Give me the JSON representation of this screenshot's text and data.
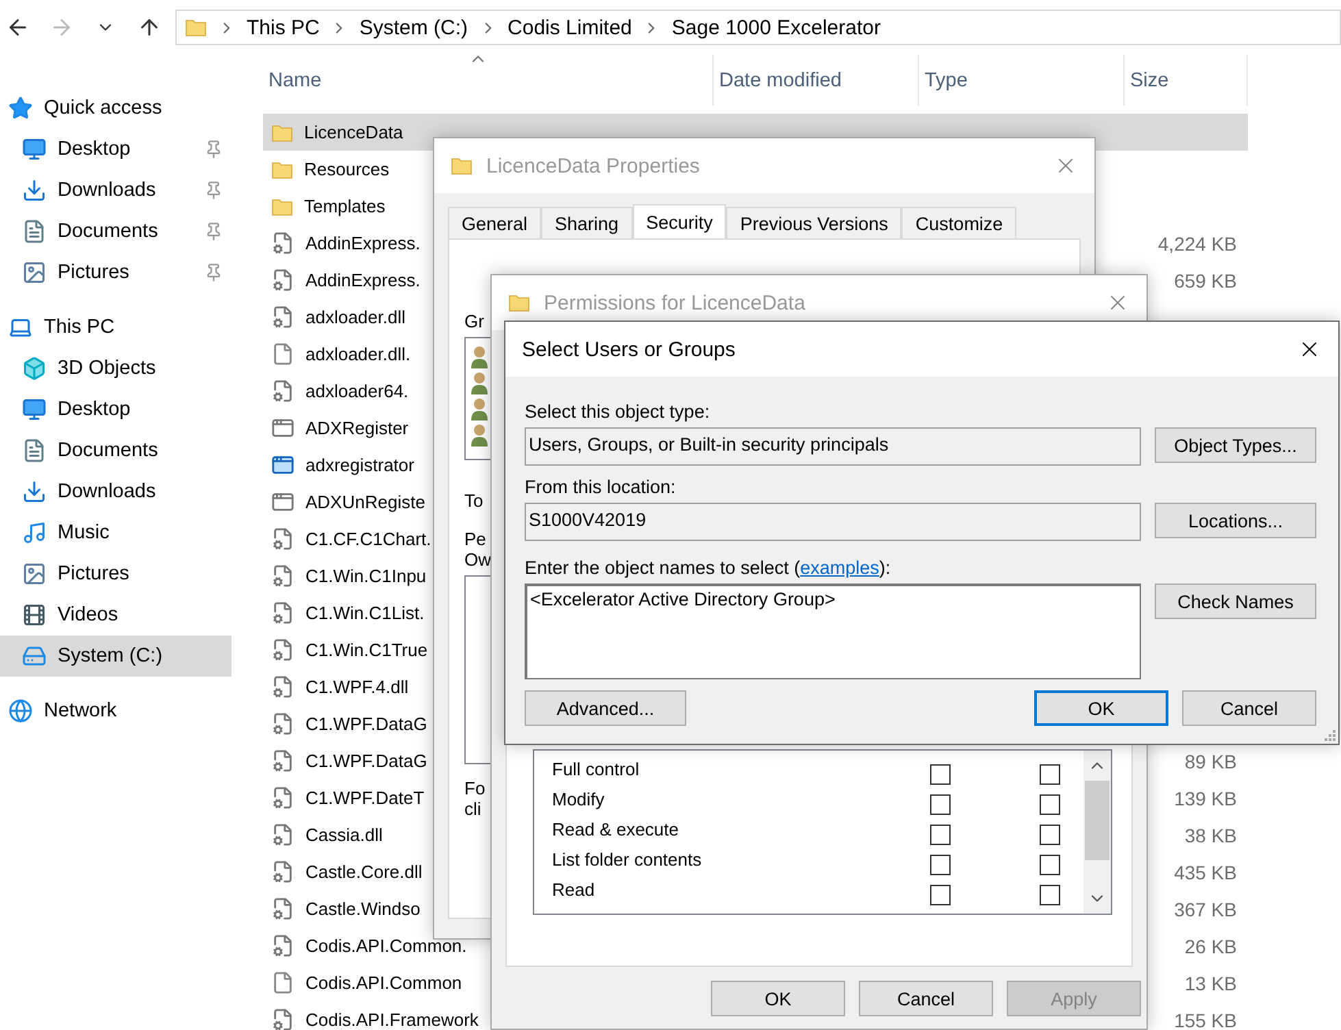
{
  "explorer": {
    "breadcrumb": [
      "This PC",
      "System (C:)",
      "Codis Limited",
      "Sage 1000 Excelerator"
    ],
    "sidebar": [
      {
        "label": "Quick access",
        "kind": "star",
        "selected": false,
        "children": [
          {
            "label": "Desktop",
            "kind": "desktop",
            "pinned": true,
            "selected": false
          },
          {
            "label": "Downloads",
            "kind": "download",
            "pinned": true,
            "selected": false
          },
          {
            "label": "Documents",
            "kind": "document",
            "pinned": true,
            "selected": false
          },
          {
            "label": "Pictures",
            "kind": "picture",
            "pinned": true,
            "selected": false
          }
        ]
      },
      {
        "label": "This PC",
        "kind": "pc",
        "selected": false,
        "children": [
          {
            "label": "3D Objects",
            "kind": "cube",
            "pinned": false,
            "selected": false
          },
          {
            "label": "Desktop",
            "kind": "desktop",
            "pinned": false,
            "selected": false
          },
          {
            "label": "Documents",
            "kind": "document",
            "pinned": false,
            "selected": false
          },
          {
            "label": "Downloads",
            "kind": "download",
            "pinned": false,
            "selected": false
          },
          {
            "label": "Music",
            "kind": "music",
            "pinned": false,
            "selected": false
          },
          {
            "label": "Pictures",
            "kind": "picture",
            "pinned": false,
            "selected": false
          },
          {
            "label": "Videos",
            "kind": "video",
            "pinned": false,
            "selected": false
          },
          {
            "label": "System (C:)",
            "kind": "drive",
            "pinned": false,
            "selected": true
          }
        ]
      },
      {
        "label": "Network",
        "kind": "network",
        "selected": false
      }
    ],
    "columns": [
      {
        "label": "Name",
        "sorted": true
      },
      {
        "label": "Date modified",
        "sorted": false
      },
      {
        "label": "Type",
        "sorted": false
      },
      {
        "label": "Size",
        "sorted": false
      }
    ],
    "files": [
      {
        "name": "LicenceData",
        "kind": "folder",
        "selected": true
      },
      {
        "name": "Resources",
        "kind": "folder",
        "selected": false
      },
      {
        "name": "Templates",
        "kind": "folder",
        "selected": false
      },
      {
        "name": "AddinExpress.",
        "kind": "dll",
        "selected": false,
        "size": "4,224 KB"
      },
      {
        "name": "AddinExpress.",
        "kind": "dll",
        "selected": false,
        "size": "659 KB"
      },
      {
        "name": "adxloader.dll",
        "kind": "dll",
        "selected": false
      },
      {
        "name": "adxloader.dll.",
        "kind": "file",
        "selected": false
      },
      {
        "name": "adxloader64.",
        "kind": "dll",
        "selected": false
      },
      {
        "name": "ADXRegister",
        "kind": "exe",
        "selected": false
      },
      {
        "name": "adxregistrator",
        "kind": "app",
        "selected": false
      },
      {
        "name": "ADXUnRegiste",
        "kind": "exe",
        "selected": false
      },
      {
        "name": "C1.CF.C1Chart.",
        "kind": "dll",
        "selected": false
      },
      {
        "name": "C1.Win.C1Inpu",
        "kind": "dll",
        "selected": false
      },
      {
        "name": "C1.Win.C1List.",
        "kind": "dll",
        "selected": false
      },
      {
        "name": "C1.Win.C1True",
        "kind": "dll",
        "selected": false
      },
      {
        "name": "C1.WPF.4.dll",
        "kind": "dll",
        "selected": false
      },
      {
        "name": "C1.WPF.DataG",
        "kind": "dll",
        "selected": false
      },
      {
        "name": "C1.WPF.DataG",
        "kind": "dll",
        "selected": false,
        "size": "89 KB"
      },
      {
        "name": "C1.WPF.DateT",
        "kind": "dll",
        "selected": false,
        "size": "139 KB"
      },
      {
        "name": "Cassia.dll",
        "kind": "dll",
        "selected": false,
        "size": "38 KB"
      },
      {
        "name": "Castle.Core.dll",
        "kind": "dll",
        "selected": false,
        "size": "435 KB"
      },
      {
        "name": "Castle.Windso",
        "kind": "dll",
        "selected": false,
        "size": "367 KB"
      },
      {
        "name": "Codis.API.Common.",
        "kind": "dll",
        "selected": false,
        "size": "26 KB"
      },
      {
        "name": "Codis.API.Common",
        "kind": "file",
        "selected": false,
        "size": "13 KB"
      },
      {
        "name": "Codis.API.Framework",
        "kind": "dll",
        "selected": false,
        "size": "155 KB"
      }
    ]
  },
  "properties": {
    "title": "LicenceData Properties",
    "tabs": [
      {
        "label": "General",
        "selected": false
      },
      {
        "label": "Sharing",
        "selected": false
      },
      {
        "label": "Security",
        "selected": true
      },
      {
        "label": "Previous Versions",
        "selected": false
      },
      {
        "label": "Customize",
        "selected": false
      }
    ],
    "group_label": "Gr",
    "to_label": "To",
    "perm_label": "Pe",
    "perm_label_2": "Ow",
    "footer_label": "Fo",
    "footer_label_2": "cli"
  },
  "permissions": {
    "title": "Permissions for LicenceData",
    "entries": [
      {
        "name": "Full control",
        "allow": false,
        "deny": false
      },
      {
        "name": "Modify",
        "allow": false,
        "deny": false
      },
      {
        "name": "Read & execute",
        "allow": false,
        "deny": false
      },
      {
        "name": "List folder contents",
        "allow": false,
        "deny": false
      },
      {
        "name": "Read",
        "allow": false,
        "deny": false
      }
    ],
    "buttons": [
      {
        "label": "OK",
        "disabled": false
      },
      {
        "label": "Cancel",
        "disabled": false
      },
      {
        "label": "Apply",
        "disabled": true
      }
    ]
  },
  "select": {
    "title": "Select Users or Groups",
    "object_type_label": "Select this object type:",
    "object_type": "Users, Groups, or Built-in security principals",
    "object_types_button": "Object Types...",
    "location_label": "From this location:",
    "location": "S1000V42019",
    "locations_button": "Locations...",
    "names_label": "Enter the object names to select (",
    "names_link": "examples",
    "names_label_end": "):",
    "names_value": "<Excelerator Active Directory Group>",
    "check_names_button": "Check Names",
    "buttons": [
      {
        "label": "Advanced...",
        "default": false
      },
      {
        "label": "OK",
        "default": true
      },
      {
        "label": "Cancel",
        "default": false
      }
    ]
  }
}
